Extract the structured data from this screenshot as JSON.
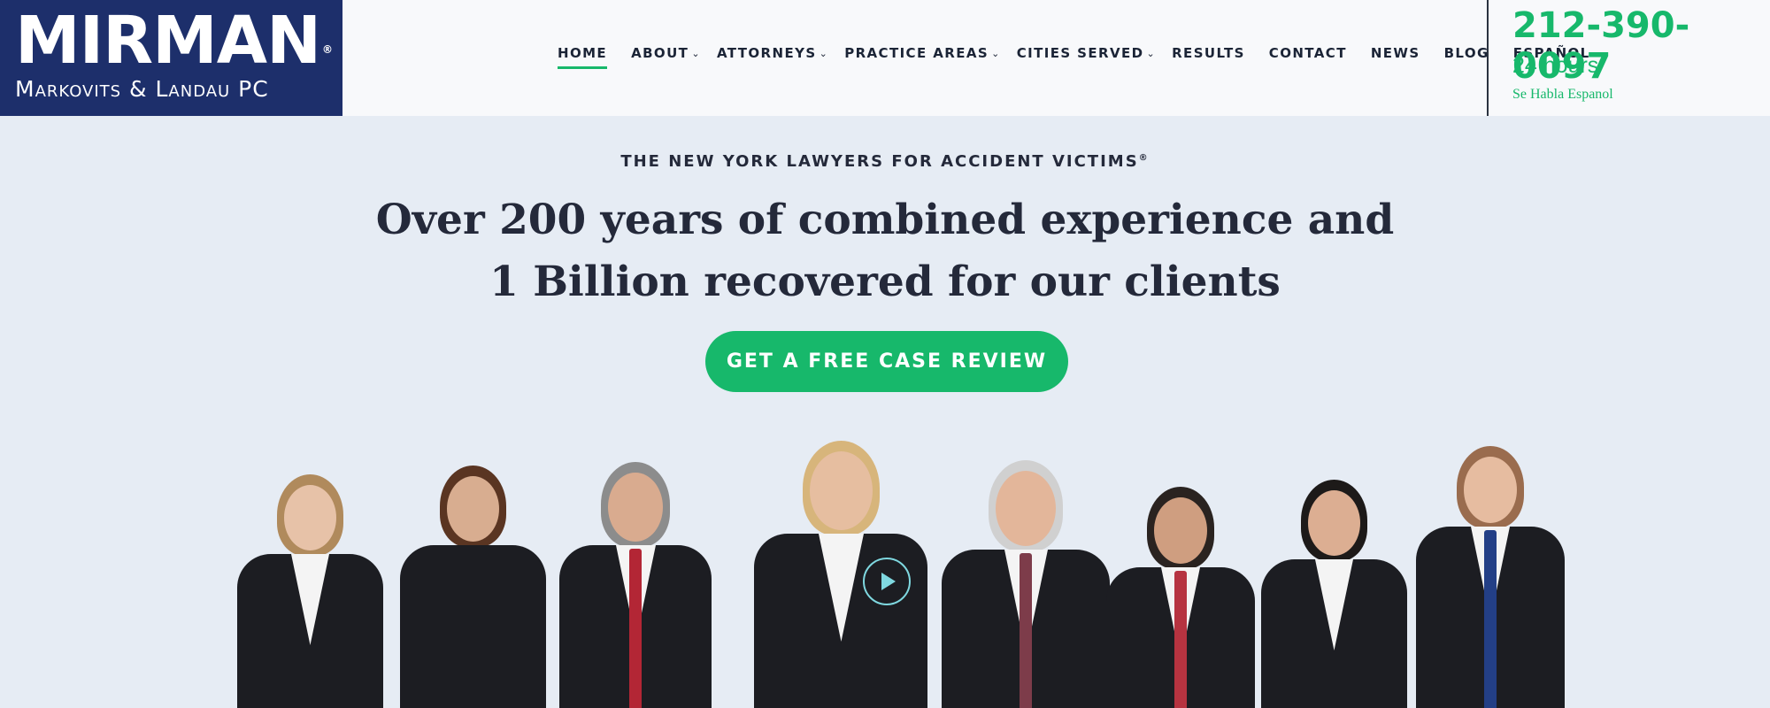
{
  "logo": {
    "main": "MIRMAN",
    "registered": "®",
    "sub": "Markovits & Landau PC"
  },
  "nav": {
    "items": [
      {
        "label": "HOME",
        "active": true,
        "dropdown": false
      },
      {
        "label": "ABOUT",
        "active": false,
        "dropdown": true
      },
      {
        "label": "ATTORNEYS",
        "active": false,
        "dropdown": true
      },
      {
        "label": "PRACTICE AREAS",
        "active": false,
        "dropdown": true
      },
      {
        "label": "CITIES SERVED",
        "active": false,
        "dropdown": true
      },
      {
        "label": "RESULTS",
        "active": false,
        "dropdown": false
      },
      {
        "label": "CONTACT",
        "active": false,
        "dropdown": false
      },
      {
        "label": "NEWS",
        "active": false,
        "dropdown": false
      },
      {
        "label": "BLOG",
        "active": false,
        "dropdown": false
      },
      {
        "label": "ESPAÑOL",
        "active": false,
        "dropdown": false
      }
    ],
    "caret": "⌄"
  },
  "contact": {
    "phone": "212-390-0097",
    "hours": "24 hours",
    "habla": "Se Habla Espanol"
  },
  "hero": {
    "eyebrow": "THE NEW YORK LAWYERS FOR ACCIDENT VICTIMS",
    "eyebrow_mark": "®",
    "line1_pre": "Over ",
    "line1_bold": "200 years",
    "line1_post": " of combined experience and",
    "line2_bold": "1 Billion",
    "line2_post": " recovered for our clients",
    "cta": "GET A FREE CASE REVIEW"
  },
  "colors": {
    "brand_navy": "#1d2f6b",
    "accent_green": "#17b86b",
    "hero_bg": "#e6ecf4",
    "text_dark": "#24293a"
  },
  "team": {
    "icon": "play-video-icon"
  }
}
